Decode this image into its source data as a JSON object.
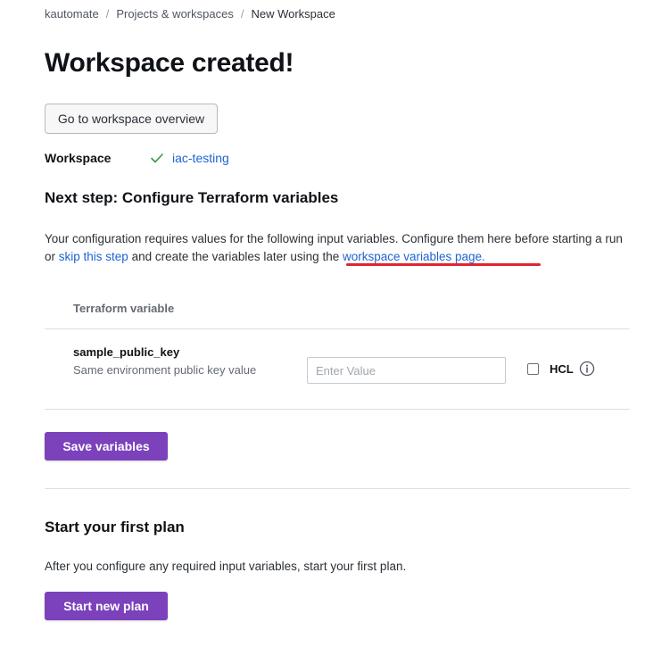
{
  "breadcrumb": {
    "items": [
      "kautomate",
      "Projects & workspaces",
      "New Workspace"
    ],
    "separator": "/"
  },
  "page_title": "Workspace created!",
  "overview_button": "Go to workspace overview",
  "workspace": {
    "label": "Workspace",
    "name": "iac-testing",
    "status_icon": "check-icon"
  },
  "next_step": {
    "title": "Next step: Configure Terraform variables",
    "desc_part1": "Your configuration requires values for the following input variables. Configure them here before starting a run or ",
    "skip_link": "skip this step",
    "desc_part2": " and create the variables later using the ",
    "variables_link": "workspace variables page."
  },
  "table": {
    "header": "Terraform variable",
    "rows": [
      {
        "name": "sample_public_key",
        "description": "Same environment public key value",
        "value": "",
        "placeholder": "Enter Value",
        "hcl_label": "HCL",
        "hcl_checked": false
      }
    ]
  },
  "save_button": "Save variables",
  "first_plan": {
    "title": "Start your first plan",
    "description": "After you configure any required input variables, start your first plan.",
    "button": "Start new plan"
  },
  "colors": {
    "primary": "#7b42bc",
    "link": "#1f63d2",
    "success": "#2e9b4a",
    "annotation": "#e0252f"
  }
}
